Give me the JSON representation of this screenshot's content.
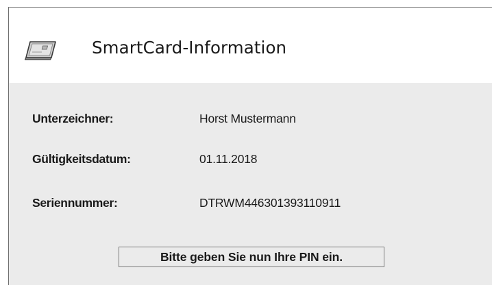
{
  "dialog": {
    "icon": "smartcard-reader-icon",
    "title": "SmartCard-Information"
  },
  "info": {
    "signer_label": "Unterzeichner:",
    "signer_value": "Horst Mustermann",
    "validity_label": "Gültigkeitsdatum:",
    "validity_value": "01.11.2018",
    "serial_label": "Seriennummer:",
    "serial_value": "DTRWM446301393110911"
  },
  "prompt": {
    "text": "Bitte geben Sie nun Ihre PIN ein."
  },
  "colors": {
    "header_background": "#ffffff",
    "body_background": "#ebebeb",
    "border": "#6e6e6e"
  }
}
